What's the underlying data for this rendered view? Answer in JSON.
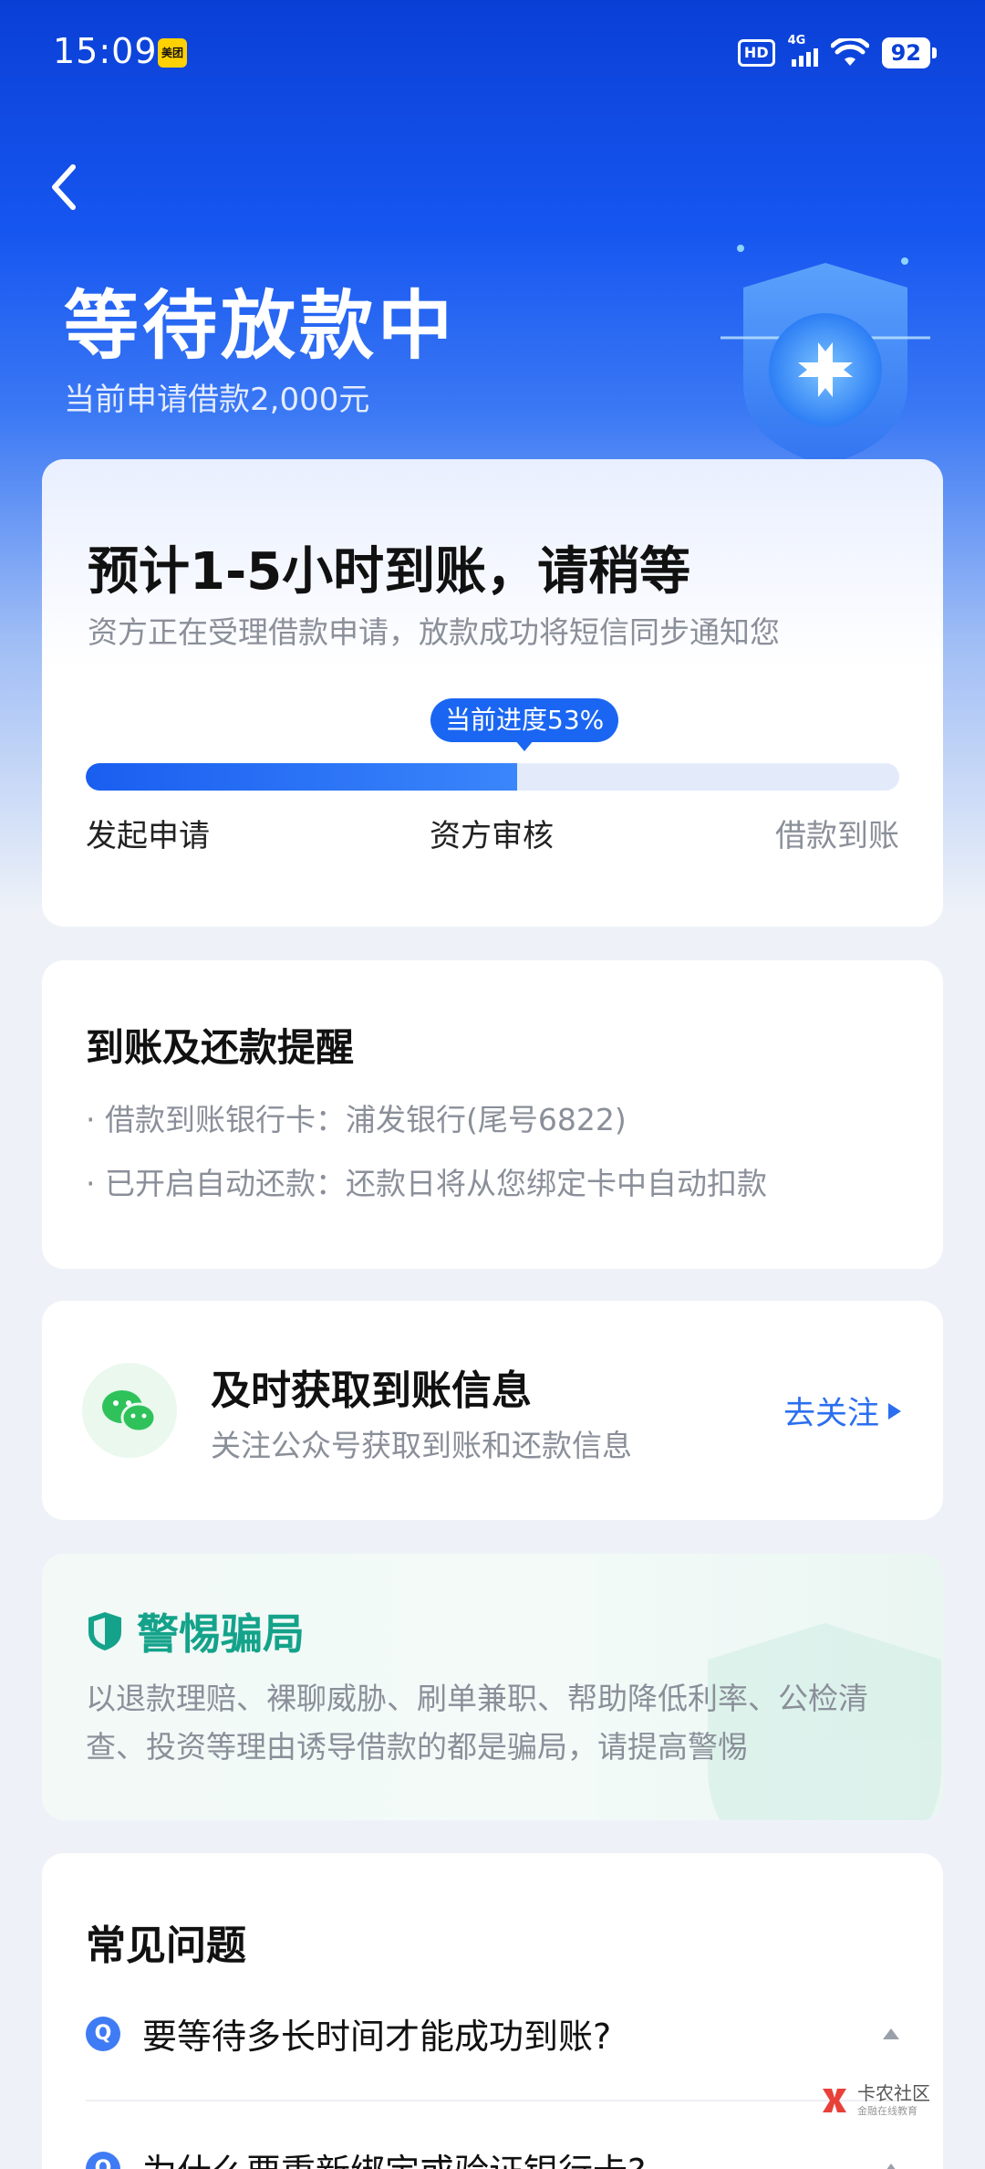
{
  "status_bar": {
    "time": "15:09",
    "app_badge": "美团",
    "hd": "HD",
    "network": "4G",
    "battery": "92"
  },
  "hero": {
    "title": "等待放款中",
    "subtitle": "当前申请借款2,000元"
  },
  "progress_card": {
    "title": "预计1-5小时到账，请稍等",
    "subtitle": "资方正在受理借款申请，放款成功将短信同步通知您",
    "tip": "当前进度53%",
    "progress": 0.53,
    "steps": [
      "发起申请",
      "资方审核",
      "借款到账"
    ]
  },
  "reminder_card": {
    "title": "到账及还款提醒",
    "items": [
      "· 借款到账银行卡：浦发银行(尾号6822)",
      "· 已开启自动还款：还款日将从您绑定卡中自动扣款"
    ]
  },
  "follow_card": {
    "title": "及时获取到账信息",
    "subtitle": "关注公众号获取到账和还款信息",
    "action": "去关注"
  },
  "warning_card": {
    "title": "警惕骗局",
    "body": "以退款理赔、裸聊威胁、刷单兼职、帮助降低利率、公检清查、投资等理由诱导借款的都是骗局，请提高警惕"
  },
  "faq_card": {
    "title": "常见问题",
    "badge": "Q",
    "items": [
      "要等待多长时间才能成功到账?",
      "为什么要重新绑定或验证银行卡?"
    ]
  },
  "watermark": {
    "name": "卡农社区",
    "sub": "金融在线教育"
  },
  "colors": {
    "primary": "#1a66f2",
    "warning_green": "#14a38a",
    "hero_top": "#0a3fd6"
  }
}
